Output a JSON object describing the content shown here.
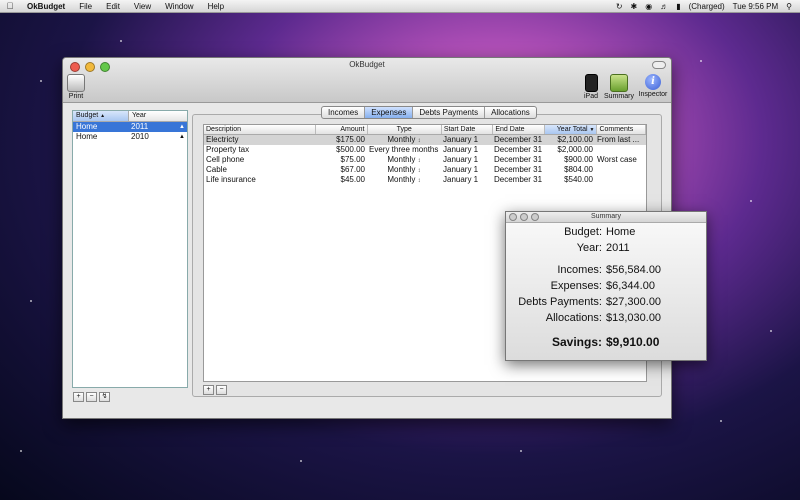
{
  "menubar": {
    "app_name": "OkBudget",
    "menus": [
      "File",
      "Edit",
      "View",
      "Window",
      "Help"
    ],
    "battery": "(Charged)",
    "clock": "Tue 9:56 PM"
  },
  "window": {
    "title": "OkBudget",
    "toolbar": {
      "print": "Print",
      "ipad": "iPad",
      "summary": "Summary",
      "inspector": "Inspector",
      "inspector_glyph": "i"
    }
  },
  "budget_list": {
    "headers": [
      "Budget",
      "Year"
    ],
    "rows": [
      {
        "budget": "Home",
        "year": "2011",
        "selected": true
      },
      {
        "budget": "Home",
        "year": "2010",
        "selected": false
      }
    ],
    "buttons": [
      "+",
      "−",
      "↯"
    ]
  },
  "tabs": [
    "Incomes",
    "Expenses",
    "Debts Payments",
    "Allocations"
  ],
  "active_tab": "Expenses",
  "expenses": {
    "headers": [
      "Description",
      "Amount",
      "Type",
      "Start Date",
      "End Date",
      "Year Total",
      "Comments"
    ],
    "rows": [
      {
        "description": "Electricty",
        "amount": "$175.00",
        "type": "Monthly",
        "start": "January 1",
        "end": "December 31",
        "total": "$2,100.00",
        "comments": "From last ..."
      },
      {
        "description": "Property tax",
        "amount": "$500.00",
        "type": "Every three months",
        "start": "January 1",
        "end": "December 31",
        "total": "$2,000.00",
        "comments": ""
      },
      {
        "description": "Cell phone",
        "amount": "$75.00",
        "type": "Monthly",
        "start": "January 1",
        "end": "December 31",
        "total": "$900.00",
        "comments": "Worst case"
      },
      {
        "description": "Cable",
        "amount": "$67.00",
        "type": "Monthly",
        "start": "January 1",
        "end": "December 31",
        "total": "$804.00",
        "comments": ""
      },
      {
        "description": "Life insurance",
        "amount": "$45.00",
        "type": "Monthly",
        "start": "January 1",
        "end": "December 31",
        "total": "$540.00",
        "comments": ""
      }
    ],
    "buttons": [
      "+",
      "−"
    ]
  },
  "summary": {
    "title": "Summary",
    "budget_label": "Budget:",
    "budget_value": "Home",
    "year_label": "Year:",
    "year_value": "2011",
    "incomes_label": "Incomes:",
    "incomes_value": "$56,584.00",
    "expenses_label": "Expenses:",
    "expenses_value": "$6,344.00",
    "debts_label": "Debts Payments:",
    "debts_value": "$27,300.00",
    "allocations_label": "Allocations:",
    "allocations_value": "$13,030.00",
    "savings_label": "Savings:",
    "savings_value": "$9,910.00"
  }
}
